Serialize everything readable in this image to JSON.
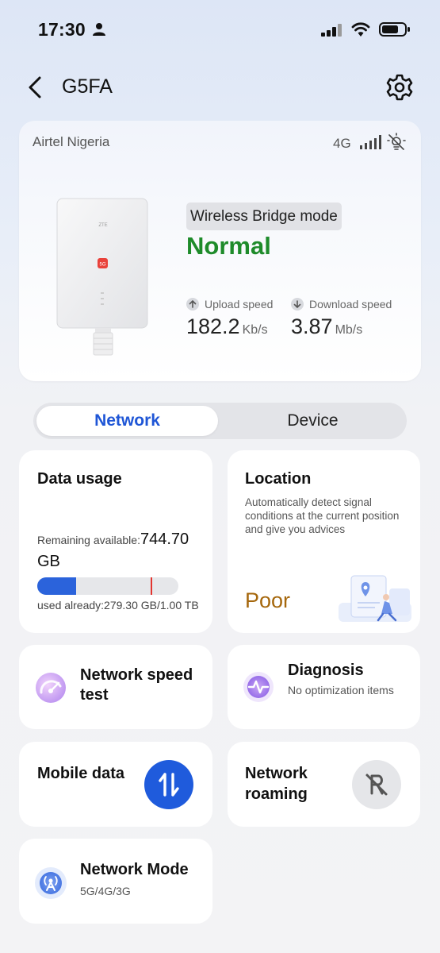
{
  "status_bar": {
    "time": "17:30"
  },
  "header": {
    "title": "G5FA"
  },
  "hero": {
    "carrier": "Airtel Nigeria",
    "network_type": "4G",
    "mode": "Wireless Bridge mode",
    "status": "Normal",
    "status_color": "#1e8b2a",
    "device_brand": "ZTE",
    "device_badge": "5G",
    "upload": {
      "label": "Upload speed",
      "value": "182.2",
      "unit": "Kb/s"
    },
    "download": {
      "label": "Download speed",
      "value": "3.87",
      "unit": "Mb/s"
    }
  },
  "tabs": [
    {
      "label": "Network",
      "active": true
    },
    {
      "label": "Device",
      "active": false
    }
  ],
  "cards": {
    "data_usage": {
      "title": "Data usage",
      "remaining_label": "Remaining available:",
      "remaining_value": "744.70 GB",
      "used_label": "used already:279.30 GB/1.00 TB",
      "used_fraction": 0.273
    },
    "location": {
      "title": "Location",
      "description": "Automatically detect signal conditions at the current position and give you advices",
      "value": "Poor",
      "value_color": "#a5670c"
    },
    "speed_test": {
      "title": "Network speed test",
      "icon": "speedometer-icon"
    },
    "diagnosis": {
      "title": "Diagnosis",
      "subtitle": "No optimization items",
      "icon": "pulse-icon"
    },
    "mobile_data": {
      "title": "Mobile data",
      "enabled": true,
      "icon": "data-transfer-icon"
    },
    "roaming": {
      "title": "Network roaming",
      "enabled": false,
      "icon": "roaming-off-icon"
    },
    "network_mode": {
      "title": "Network Mode",
      "subtitle": "5G/4G/3G",
      "icon": "antenna-icon"
    }
  },
  "colors": {
    "accent": "#1f56d6",
    "toggle_on": "#1f5bdc"
  }
}
